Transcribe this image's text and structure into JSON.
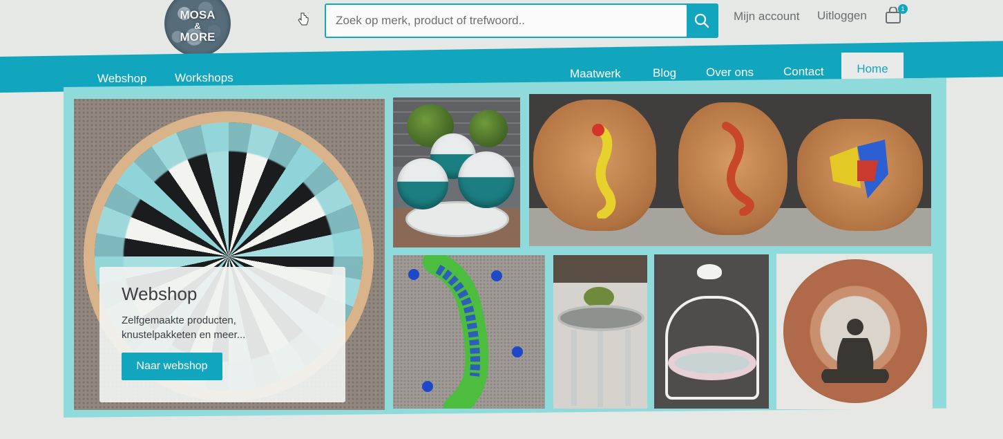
{
  "logo": {
    "line1": "MOSA",
    "line2": "&",
    "line3": "MORE"
  },
  "search": {
    "placeholder": "Zoek op merk, product of trefwoord.."
  },
  "header": {
    "account_label": "Mijn account",
    "logout_label": "Uitloggen",
    "cart_count": "1"
  },
  "nav": {
    "left": [
      "Webshop",
      "Workshops"
    ],
    "right": [
      "Maatwerk",
      "Blog",
      "Over ons",
      "Contact"
    ],
    "active": "Home"
  },
  "hero": {
    "card": {
      "title": "Webshop",
      "text": "Zelfgemaakte producten, knustelpakketen en meer...",
      "button": "Naar webshop"
    }
  },
  "colors": {
    "accent": "#12a5be",
    "frame": "#8fdbdb",
    "background": "#e6e8e6"
  },
  "icons": [
    "search-icon",
    "cart-icon",
    "pointer-cursor-icon"
  ]
}
